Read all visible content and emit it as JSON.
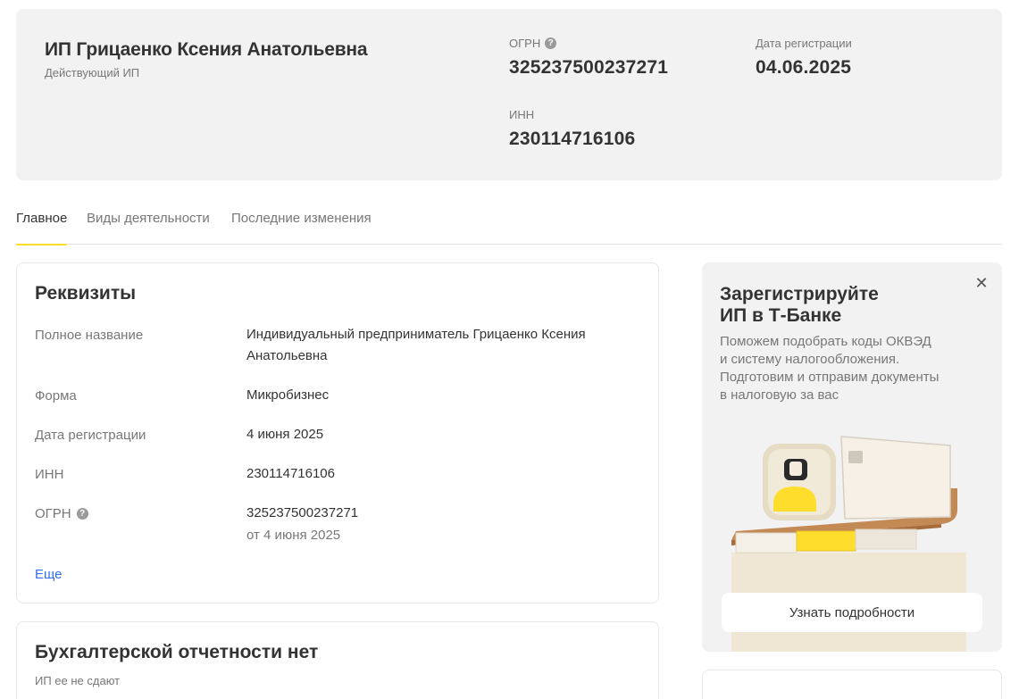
{
  "hero": {
    "name": "ИП Грицаенко Ксения Анатольевна",
    "status": "Действующий ИП",
    "ogrn_label": "ОГРН",
    "ogrn_value": "325237500237271",
    "reg_label": "Дата регистрации",
    "reg_value": "04.06.2025",
    "inn_label": "ИНН",
    "inn_value": "230114716106"
  },
  "tabs": [
    {
      "label": "Главное",
      "active": true
    },
    {
      "label": "Виды деятельности",
      "active": false
    },
    {
      "label": "Последние изменения",
      "active": false
    }
  ],
  "requisites": {
    "title": "Реквизиты",
    "rows": [
      {
        "label": "Полное название",
        "value_line1": "Индивидуальный предприниматель Грицаенко Ксения",
        "value_line2": "Анатольевна"
      },
      {
        "label": "Форма",
        "value": "Микробизнес"
      },
      {
        "label": "Дата регистрации",
        "value": "4 июня 2025"
      },
      {
        "label": "ИНН",
        "value": "230114716106"
      },
      {
        "label": "ОГРН",
        "value": "325237500237271",
        "sub": "от 4 июня 2025"
      }
    ],
    "more": "Еще"
  },
  "accounting": {
    "title": "Бухгалтерской отчетности нет",
    "note": "ИП ее не сдают"
  },
  "promo": {
    "title_line1": "Зарегистрируйте",
    "title_line2": "ИП в Т-Банке",
    "text_lines": [
      "Поможем подобрать коды ОКВЭД",
      "и систему налогообложения.",
      "Подготовим и отправим документы",
      "в налоговую за вас"
    ],
    "cta": "Узнать подробности",
    "close_icon": "close-icon"
  },
  "colors": {
    "accent_yellow": "#ffdd2d",
    "link_blue": "#336fee",
    "panel_gray": "#f2f2f2"
  }
}
